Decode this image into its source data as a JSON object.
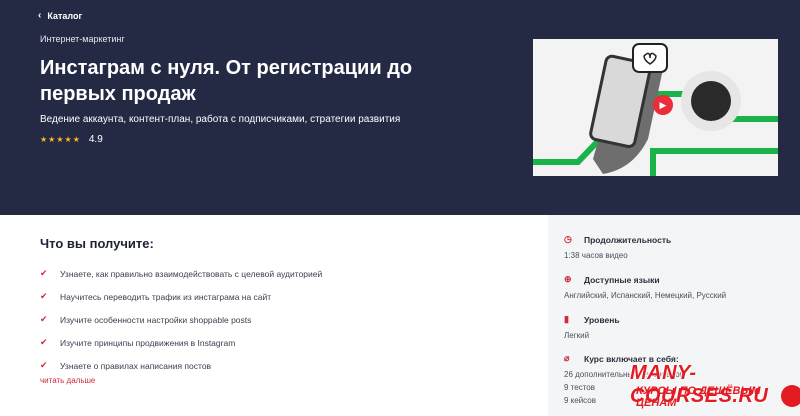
{
  "header": {
    "back_label": "Каталог",
    "category": "Интернет-маркетинг",
    "title": "Инстаграм с нуля. От регистрации до первых продаж",
    "subtitle": "Ведение аккаунта, контент-план, работа с подписчиками, стратегии развития",
    "stars": "★★★★★",
    "rating": "4.9"
  },
  "gains": {
    "title": "Что вы получите:",
    "items": [
      "Узнаете, как правильно взаимодействовать с целевой аудиторией",
      "Научитесь переводить трафик из инстаграма на сайт",
      "Изучите особенности настройки shoppable posts",
      "Изучите принципы продвижения в Instagram",
      "Узнаете о правилах написания постов"
    ],
    "more_label": "читать дальше"
  },
  "sidebar": {
    "duration_label": "Продолжительность",
    "duration_value": "1:38 часов видео",
    "languages_label": "Доступные языки",
    "languages_value": "Английский, Испанский, Немецкий, Русский",
    "level_label": "Уровень",
    "level_value": "Легкий",
    "includes_label": "Курс включает в себя:",
    "includes_values": [
      "26 дополнительных материалов",
      "9 тестов",
      "9 кейсов"
    ]
  },
  "watermark": {
    "main": "MANY-COURSES.RU",
    "sub": "КУРСЫ ПО ДЕШЁВЫМ ЦЕНАМ"
  },
  "colors": {
    "hero_bg": "#242a44",
    "accent": "#d1273a",
    "star": "#ffb520",
    "play": "#ea2c3b",
    "preview_green": "#19b34a"
  }
}
